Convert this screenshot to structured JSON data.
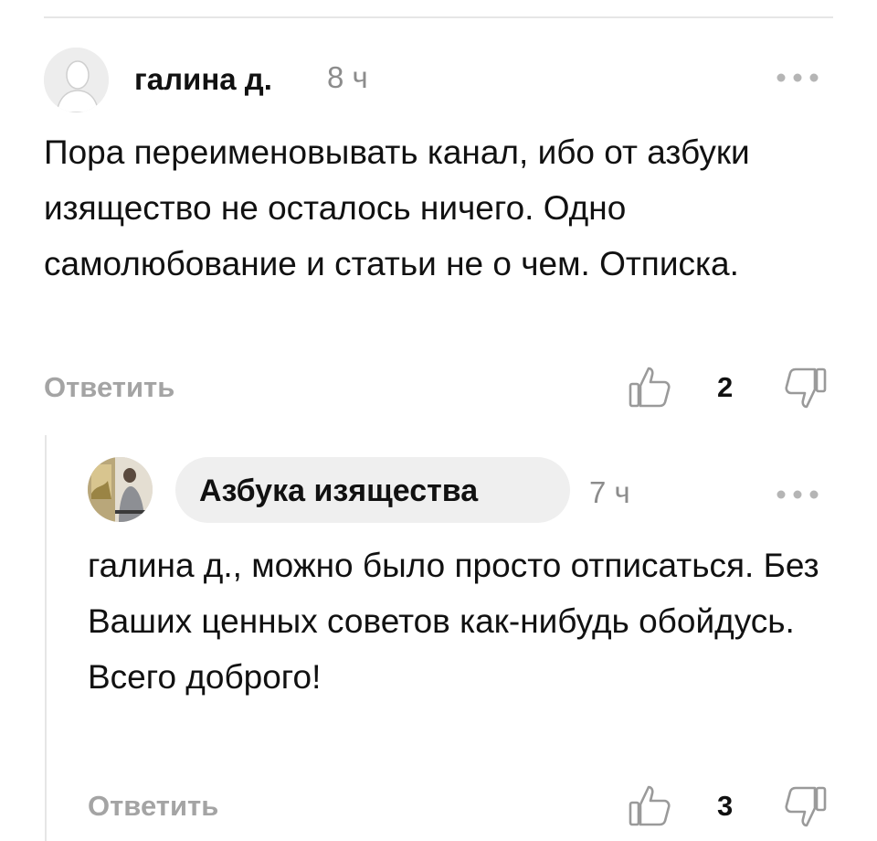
{
  "comments": [
    {
      "author": "галина д.",
      "time": "8 ч",
      "text": "Пора переименовывать канал, ибо от азбуки изящество не осталось ничего. Одно самолюбование и статьи не о чем. Отписка.",
      "reply_label": "Ответить",
      "likes": "2",
      "avatar": "default-user-avatar"
    },
    {
      "author": "Азбука изящества",
      "time": "7 ч",
      "text": "галина д., можно было просто отписаться. Без Ваших ценных советов как-нибудь обойдусь. Всего доброго!",
      "reply_label": "Ответить",
      "likes": "3",
      "avatar": "channel-photo-avatar",
      "author_highlighted": true
    }
  ],
  "icons": {
    "more": "more-horizontal-icon",
    "like": "thumbs-up-icon",
    "dislike": "thumbs-down-icon"
  },
  "colors": {
    "muted_text": "#a4a4a4",
    "timestamp": "#8c8c8c",
    "pill_bg": "#efefef",
    "divider": "#e6e6e6"
  }
}
